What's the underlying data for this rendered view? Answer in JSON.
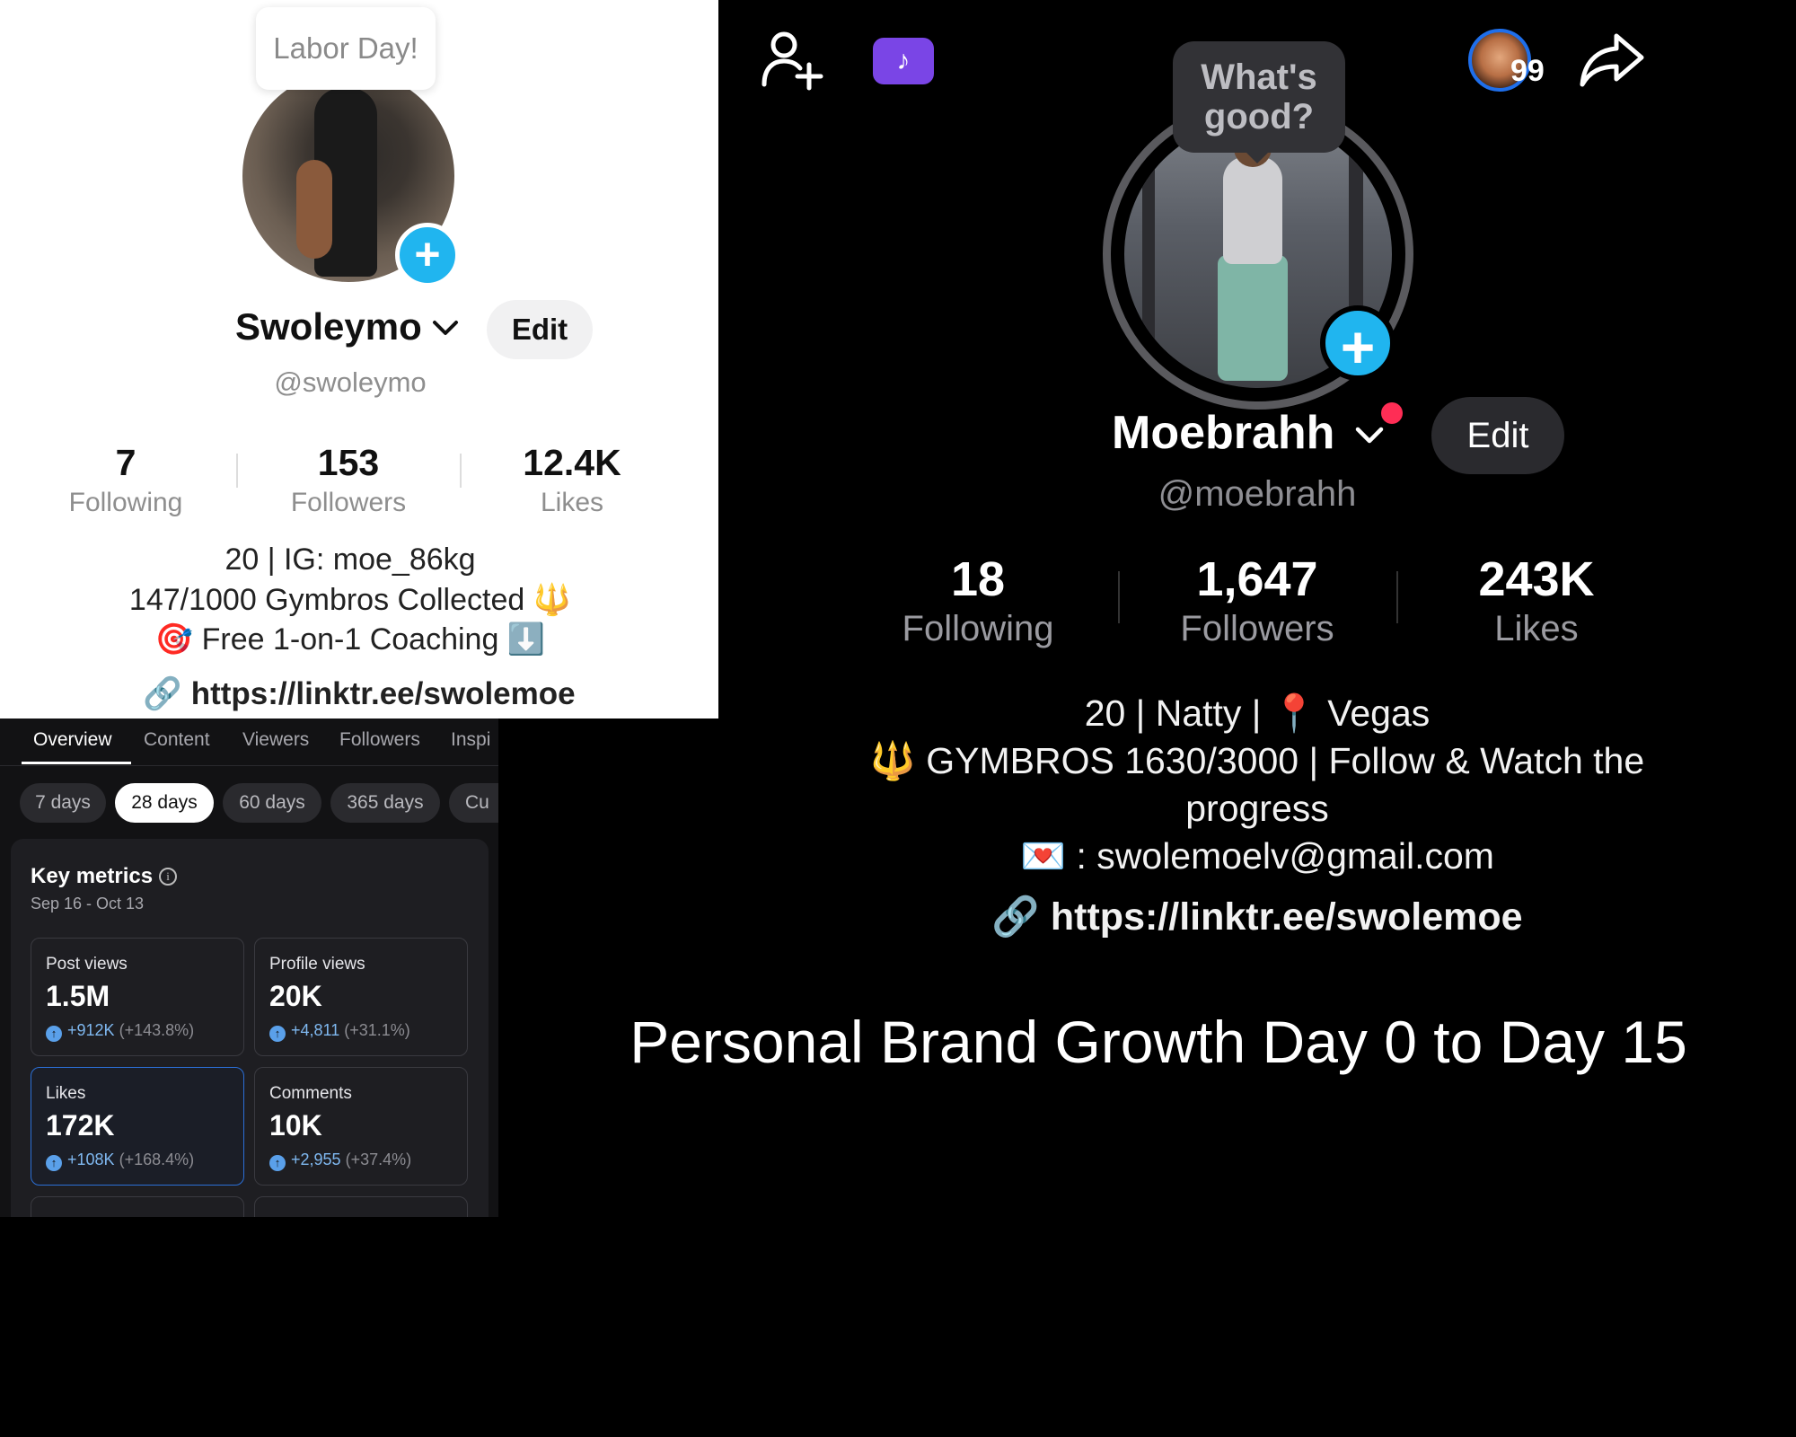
{
  "left_profile": {
    "bubble": "Labor Day!",
    "name": "Swoleymo",
    "edit_label": "Edit",
    "handle": "@swoleymo",
    "stats": [
      {
        "value": "7",
        "label": "Following"
      },
      {
        "value": "153",
        "label": "Followers"
      },
      {
        "value": "12.4K",
        "label": "Likes"
      }
    ],
    "bio": [
      "20 | IG: moe_86kg",
      "147/1000 Gymbros Collected 🔱",
      "🎯 Free 1-on-1 Coaching ⬇️"
    ],
    "link": "https://linktr.ee/swolemoe"
  },
  "analytics": {
    "tabs": [
      "Overview",
      "Content",
      "Viewers",
      "Followers",
      "Inspi"
    ],
    "ranges": [
      "7 days",
      "28 days",
      "60 days",
      "365 days",
      "Cu"
    ],
    "active_range": "28 days",
    "title": "Key metrics",
    "date_range": "Sep 16 - Oct 13",
    "metrics": [
      {
        "label": "Post views",
        "value": "1.5M",
        "delta": "+912K",
        "pct": "(+143.8%)"
      },
      {
        "label": "Profile views",
        "value": "20K",
        "delta": "+4,811",
        "pct": "(+31.1%)"
      },
      {
        "label": "Likes",
        "value": "172K",
        "delta": "+108K",
        "pct": "(+168.4%)"
      },
      {
        "label": "Comments",
        "value": "10K",
        "delta": "+2,955",
        "pct": "(+37.4%)"
      }
    ]
  },
  "right_profile": {
    "bubble": "What's good?",
    "badge_count": "99",
    "name": "Moebrahh",
    "edit_label": "Edit",
    "handle": "@moebrahh",
    "stats": [
      {
        "value": "18",
        "label": "Following"
      },
      {
        "value": "1,647",
        "label": "Followers"
      },
      {
        "value": "243K",
        "label": "Likes"
      }
    ],
    "bio": [
      "20 | Natty | 📍 Vegas",
      "🔱 GYMBROS 1630/3000 | Follow & Watch the",
      "progress",
      "💌 : swolemoelv@gmail.com"
    ],
    "link": "https://linktr.ee/swolemoe"
  },
  "caption": "Personal Brand Growth Day 0 to Day 15",
  "colors": {
    "accent_blue": "#20b5ef",
    "ticket_purple": "#7a45e6",
    "notify_red": "#ff2d55"
  }
}
